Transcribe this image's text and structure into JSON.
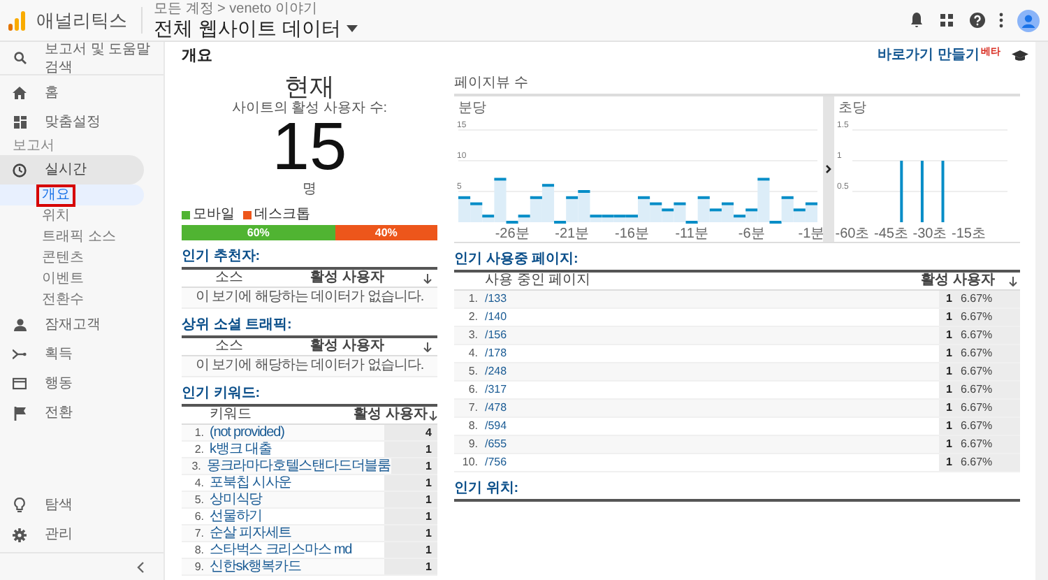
{
  "header": {
    "app_name": "애널리틱스",
    "breadcrumb": "모든 계정 > veneto 이야기",
    "property": "전체 웹사이트 데이터"
  },
  "sidebar": {
    "search": "보고서 및 도움말 검색",
    "top_items": [
      {
        "label": "홈"
      },
      {
        "label": "맞춤설정"
      }
    ],
    "section_label": "보고서",
    "reports": [
      {
        "label": "실시간",
        "expanded": true,
        "children": [
          {
            "label": "개요",
            "selected": true,
            "annotated": true
          },
          {
            "label": "위치",
            "selected": false,
            "annotated": false
          },
          {
            "label": "트래픽 소스",
            "selected": false,
            "annotated": false
          },
          {
            "label": "콘텐츠",
            "selected": false,
            "annotated": false
          },
          {
            "label": "이벤트",
            "selected": false,
            "annotated": false
          },
          {
            "label": "전환수",
            "selected": false,
            "annotated": false
          }
        ]
      },
      {
        "label": "잠재고객",
        "expanded": false
      },
      {
        "label": "획득",
        "expanded": false
      },
      {
        "label": "행동",
        "expanded": false
      },
      {
        "label": "전환",
        "expanded": false
      }
    ],
    "bottom_items": [
      {
        "label": "탐색"
      },
      {
        "label": "관리"
      }
    ]
  },
  "page_title": "개요",
  "shortcut": {
    "label": "바로가기 만들기",
    "badge": "베타"
  },
  "now": {
    "title": "현재",
    "subtitle": "사이트의 활성 사용자 수:",
    "count": "15",
    "unit": "명",
    "devices": [
      {
        "label": "모바일",
        "color": "#50b432",
        "level": 0.6,
        "reading": "60%"
      },
      {
        "label": "데스크톱",
        "color": "#ed561b",
        "level": 0.4,
        "reading": "40%"
      }
    ]
  },
  "pageviews": {
    "title": "페이지뷰 수",
    "per_minute": {
      "chart_data": {
        "type": "bar",
        "title": "분당",
        "x": [
          -30,
          -29,
          -28,
          -27,
          -26,
          -25,
          -24,
          -23,
          -22,
          -21,
          -20,
          -19,
          -18,
          -17,
          -16,
          -15,
          -14,
          -13,
          -12,
          -11,
          -10,
          -9,
          -8,
          -7,
          -6,
          -5,
          -4,
          -3,
          -2,
          -1
        ],
        "series": [
          {
            "color": "#dcedf8",
            "values": [
              4,
              3,
              1,
              7,
              0,
              1,
              4,
              6,
              0,
              4,
              5,
              1,
              1,
              1,
              1,
              4,
              3,
              2,
              3,
              0,
              4,
              2,
              3,
              1,
              2,
              7,
              0,
              4,
              2,
              3
            ]
          }
        ],
        "xlim": [
          -30.5,
          -0.5
        ],
        "ylim": [
          0,
          15
        ],
        "yticks": [
          5,
          10,
          15
        ],
        "xticks": [
          {
            "value": -26,
            "label": "-26분"
          },
          {
            "value": -21,
            "label": "-21분"
          },
          {
            "value": -16,
            "label": "-16분"
          },
          {
            "value": -11,
            "label": "-11분"
          },
          {
            "value": -6,
            "label": "-6분"
          },
          {
            "value": -1,
            "label": "-1분"
          }
        ]
      }
    },
    "per_second": {
      "chart_data": {
        "type": "bar",
        "title": "초당",
        "x": [
          -41,
          -33,
          -25
        ],
        "series": [
          {
            "color": "#058dc7",
            "values": [
              1,
              1,
              1
            ]
          }
        ],
        "xlim": [
          -60,
          0
        ],
        "ylim": [
          0,
          1.5
        ],
        "yticks": [
          0.5,
          1,
          1.5
        ],
        "xticks": [
          {
            "value": -60,
            "label": "-60초"
          },
          {
            "value": -45,
            "label": "-45초"
          },
          {
            "value": -30,
            "label": "-30초"
          },
          {
            "value": -15,
            "label": "-15초"
          }
        ]
      }
    }
  },
  "referrers": {
    "title": "인기 추천자:",
    "columns": [
      "소스",
      "활성 사용자"
    ],
    "empty": "이 보기에 해당하는 데이터가 없습니다."
  },
  "social": {
    "title": "상위 소셜 트래픽:",
    "columns": [
      "소스",
      "활성 사용자"
    ],
    "empty": "이 보기에 해당하는 데이터가 없습니다."
  },
  "keywords": {
    "title": "인기 키워드:",
    "columns": [
      "키워드",
      "활성 사용자"
    ],
    "rows": [
      {
        "rank": "1.",
        "keyword": "(not provided)",
        "users": "4"
      },
      {
        "rank": "2.",
        "keyword": "k뱅크 대출",
        "users": "1"
      },
      {
        "rank": "3.",
        "keyword": "몽크라마다호텔스탠다드더블룸",
        "users": "1"
      },
      {
        "rank": "4.",
        "keyword": "포북칩 시사운",
        "users": "1"
      },
      {
        "rank": "5.",
        "keyword": "상미식당",
        "users": "1"
      },
      {
        "rank": "6.",
        "keyword": "선물하기",
        "users": "1"
      },
      {
        "rank": "7.",
        "keyword": "순살 피자세트",
        "users": "1"
      },
      {
        "rank": "8.",
        "keyword": "스타벅스 크리스마스 md",
        "users": "1"
      },
      {
        "rank": "9.",
        "keyword": "신한sk행복카드",
        "users": "1"
      }
    ]
  },
  "pages": {
    "title": "인기 사용중 페이지:",
    "columns": [
      "사용 중인 페이지",
      "활성 사용자"
    ],
    "rows": [
      {
        "rank": "1.",
        "page": "/133",
        "users": "1",
        "percent": "6.67%"
      },
      {
        "rank": "2.",
        "page": "/140",
        "users": "1",
        "percent": "6.67%"
      },
      {
        "rank": "3.",
        "page": "/156",
        "users": "1",
        "percent": "6.67%"
      },
      {
        "rank": "4.",
        "page": "/178",
        "users": "1",
        "percent": "6.67%"
      },
      {
        "rank": "5.",
        "page": "/248",
        "users": "1",
        "percent": "6.67%"
      },
      {
        "rank": "6.",
        "page": "/317",
        "users": "1",
        "percent": "6.67%"
      },
      {
        "rank": "7.",
        "page": "/478",
        "users": "1",
        "percent": "6.67%"
      },
      {
        "rank": "8.",
        "page": "/594",
        "users": "1",
        "percent": "6.67%"
      },
      {
        "rank": "9.",
        "page": "/655",
        "users": "1",
        "percent": "6.67%"
      },
      {
        "rank": "10.",
        "page": "/756",
        "users": "1",
        "percent": "6.67%"
      }
    ]
  },
  "locations": {
    "title": "인기 위치:"
  }
}
